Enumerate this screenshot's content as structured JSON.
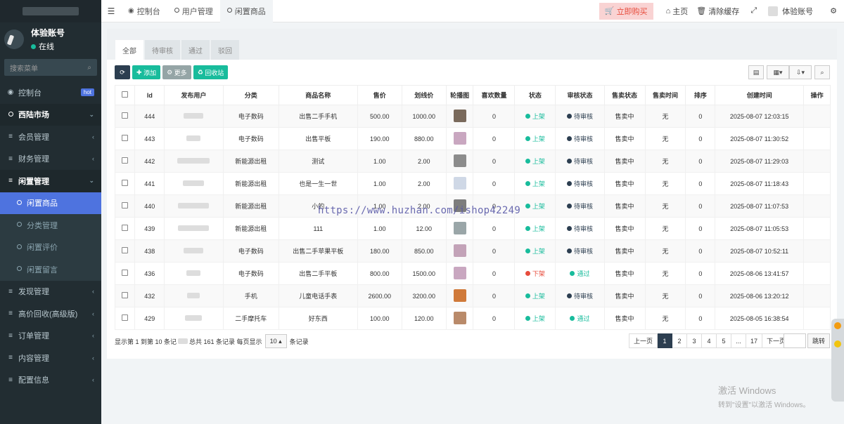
{
  "sidebar": {
    "user_name": "体验账号",
    "user_status": "在线",
    "search_placeholder": "搜索菜单",
    "items": [
      {
        "label": "控制台",
        "badge": "hot"
      },
      {
        "label": "西陆市场"
      },
      {
        "label": "会员管理"
      },
      {
        "label": "财务管理"
      },
      {
        "label": "闲置管理"
      },
      {
        "label": "闲置商品"
      },
      {
        "label": "分类管理"
      },
      {
        "label": "闲置评价"
      },
      {
        "label": "闲置留言"
      },
      {
        "label": "发现管理"
      },
      {
        "label": "高价回收(高级版)"
      },
      {
        "label": "订单管理"
      },
      {
        "label": "内容管理"
      },
      {
        "label": "配置信息"
      }
    ]
  },
  "topbar": {
    "tabs": [
      "控制台",
      "用户管理",
      "闲置商品"
    ],
    "buy_label": "立即购买",
    "home_label": "主页",
    "clear_cache_label": "清除缓存",
    "account_label": "体验账号"
  },
  "panel_tabs": [
    "全部",
    "待审核",
    "通过",
    "驳回"
  ],
  "toolbar": {
    "add_label": "添加",
    "more_label": "更多",
    "recycle_label": "回收站"
  },
  "table": {
    "headers": [
      "Id",
      "发布用户",
      "分类",
      "商品名称",
      "售价",
      "划线价",
      "轮播图",
      "喜欢数量",
      "状态",
      "审核状态",
      "售卖状态",
      "售卖时间",
      "排序",
      "创建时间",
      "操作"
    ],
    "rows": [
      {
        "id": "444",
        "category": "电子数码",
        "name": "出售二手手机",
        "price": "500.00",
        "orig": "1000.00",
        "likes": "0",
        "status": "上架",
        "audit": "待审核",
        "sale": "售卖中",
        "sale_time": "无",
        "sort": "0",
        "created": "2025-08-07 12:03:15"
      },
      {
        "id": "443",
        "category": "电子数码",
        "name": "出售平板",
        "price": "190.00",
        "orig": "880.00",
        "likes": "0",
        "status": "上架",
        "audit": "待审核",
        "sale": "售卖中",
        "sale_time": "无",
        "sort": "0",
        "created": "2025-08-07 11:30:52"
      },
      {
        "id": "442",
        "category": "新能源出租",
        "name": "测试",
        "price": "1.00",
        "orig": "2.00",
        "likes": "0",
        "status": "上架",
        "audit": "待审核",
        "sale": "售卖中",
        "sale_time": "无",
        "sort": "0",
        "created": "2025-08-07 11:29:03"
      },
      {
        "id": "441",
        "category": "新能源出租",
        "name": "也是一生一世",
        "price": "1.00",
        "orig": "2.00",
        "likes": "0",
        "status": "上架",
        "audit": "待审核",
        "sale": "售卖中",
        "sale_time": "无",
        "sort": "0",
        "created": "2025-08-07 11:18:43"
      },
      {
        "id": "440",
        "category": "新能源出租",
        "name": "小的",
        "price": "1.00",
        "orig": "2.00",
        "likes": "0",
        "status": "上架",
        "audit": "待审核",
        "sale": "售卖中",
        "sale_time": "无",
        "sort": "0",
        "created": "2025-08-07 11:07:53"
      },
      {
        "id": "439",
        "category": "新能源出租",
        "name": "111",
        "price": "1.00",
        "orig": "12.00",
        "likes": "0",
        "status": "上架",
        "audit": "待审核",
        "sale": "售卖中",
        "sale_time": "无",
        "sort": "0",
        "created": "2025-08-07 11:05:53"
      },
      {
        "id": "438",
        "category": "电子数码",
        "name": "出售二手苹果平板",
        "price": "180.00",
        "orig": "850.00",
        "likes": "0",
        "status": "上架",
        "audit": "待审核",
        "sale": "售卖中",
        "sale_time": "无",
        "sort": "0",
        "created": "2025-08-07 10:52:11"
      },
      {
        "id": "436",
        "category": "电子数码",
        "name": "出售二手平板",
        "price": "800.00",
        "orig": "1500.00",
        "likes": "0",
        "status": "下架",
        "audit": "通过",
        "sale": "售卖中",
        "sale_time": "无",
        "sort": "0",
        "created": "2025-08-06 13:41:57"
      },
      {
        "id": "432",
        "category": "手机",
        "name": "儿童电话手表",
        "price": "2600.00",
        "orig": "3200.00",
        "likes": "0",
        "status": "上架",
        "audit": "待审核",
        "sale": "售卖中",
        "sale_time": "无",
        "sort": "0",
        "created": "2025-08-06 13:20:12"
      },
      {
        "id": "429",
        "category": "二手摩托车",
        "name": "好东西",
        "price": "100.00",
        "orig": "120.00",
        "likes": "0",
        "status": "上架",
        "audit": "通过",
        "sale": "售卖中",
        "sale_time": "无",
        "sort": "0",
        "created": "2025-08-05 16:38:54"
      }
    ]
  },
  "footer": {
    "summary_left": "显示第 1 到第 10 条记",
    "summary_mid": "总共 161 条记录 每页显示",
    "page_size": "10",
    "summary_right": "条记录"
  },
  "pager": {
    "prev": "上一页",
    "pages": [
      "1",
      "2",
      "3",
      "4",
      "5",
      "...",
      "17"
    ],
    "next": "下一页",
    "jump": "跳转"
  },
  "watermark_url": "https://www.huzhan.com/ishop42249",
  "windows": {
    "line1": "激活 Windows",
    "line2": "转到\"设置\"以激活 Windows。"
  },
  "colors": {
    "sidebar_bg": "#222d32",
    "active": "#4e73df",
    "green": "#18bc9c",
    "red": "#e74c3c",
    "navy": "#2c3e50"
  }
}
